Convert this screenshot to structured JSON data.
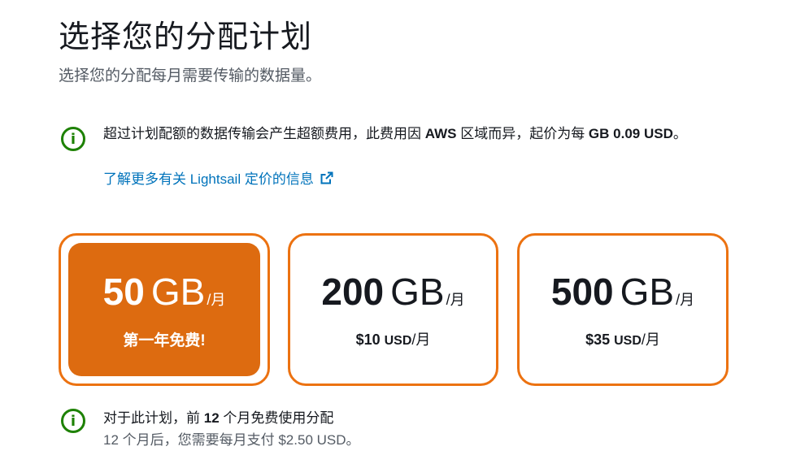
{
  "header": {
    "title": "选择您的分配计划",
    "subtitle": "选择您的分配每月需要传输的数据量。"
  },
  "overage_notice": {
    "text_part1": "超过计划配额的数据传输会产生超额费用，此费用因 ",
    "text_bold1": "AWS",
    "text_part2": " 区域而异，起价为每 ",
    "text_bold2": "GB 0.09 USD",
    "text_part3": "。",
    "link_label": "了解更多有关 Lightsail 定价的信息",
    "icon": "info-icon",
    "link_icon": "external-link-icon"
  },
  "plans": [
    {
      "size_num": "50",
      "size_unit": "GB",
      "per": "/月",
      "note": "第一年免费!",
      "selected": true
    },
    {
      "size_num": "200",
      "size_unit": "GB",
      "per": "/月",
      "price_amt": "$10",
      "price_cur": "USD",
      "price_per": "/月",
      "selected": false
    },
    {
      "size_num": "500",
      "size_unit": "GB",
      "per": "/月",
      "price_amt": "$35",
      "price_cur": "USD",
      "price_per": "/月",
      "selected": false
    }
  ],
  "plan_notice": {
    "line1_part1": "对于此计划，前 ",
    "line1_bold": "12",
    "line1_part2": " 个月免费使用分配",
    "line2": "12 个月后，您需要每月支付 $2.50 USD。",
    "icon": "info-icon"
  },
  "colors": {
    "accent_orange": "#ec7211",
    "selected_fill": "#dd6b10",
    "info_green": "#1d8102",
    "link_blue": "#0073bb"
  }
}
